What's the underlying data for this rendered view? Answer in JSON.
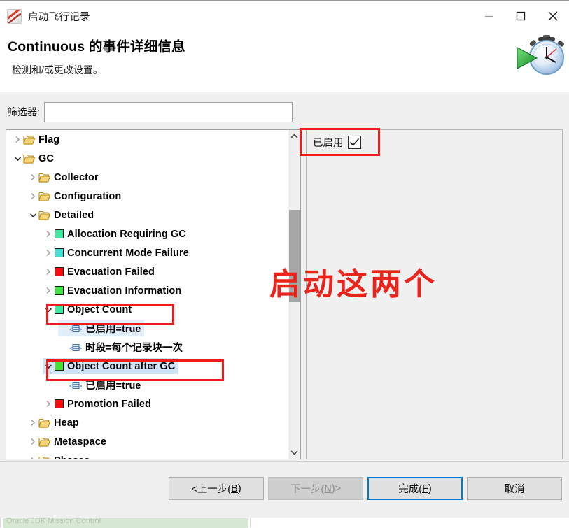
{
  "window": {
    "title": "启动飞行记录",
    "icon": "jfr-rocket-icon",
    "controls": {
      "minimize": "minimize-icon",
      "maximize": "maximize-icon",
      "close": "close-icon"
    }
  },
  "header": {
    "title": "Continuous 的事件详细信息",
    "subtitle": "检测和/或更改设置。",
    "art_icon": "stopwatch-play-icon"
  },
  "filter": {
    "label": "筛选器:",
    "value": "",
    "placeholder": ""
  },
  "tree": {
    "rows": [
      {
        "indent": 1,
        "twisty": "collapsed",
        "icon": "folder",
        "label": "Flag"
      },
      {
        "indent": 1,
        "twisty": "expanded",
        "icon": "folder",
        "label": "GC"
      },
      {
        "indent": 2,
        "twisty": "collapsed",
        "icon": "folder",
        "label": "Collector"
      },
      {
        "indent": 2,
        "twisty": "collapsed",
        "icon": "folder",
        "label": "Configuration"
      },
      {
        "indent": 2,
        "twisty": "expanded",
        "icon": "folder",
        "label": "Detailed"
      },
      {
        "indent": 3,
        "twisty": "collapsed",
        "icon": "color",
        "color": "#3ce9a0",
        "label": "Allocation Requiring GC"
      },
      {
        "indent": 3,
        "twisty": "collapsed",
        "icon": "color",
        "color": "#45e0d8",
        "label": "Concurrent Mode Failure"
      },
      {
        "indent": 3,
        "twisty": "collapsed",
        "icon": "color",
        "color": "#fa0a0a",
        "label": "Evacuation Failed"
      },
      {
        "indent": 3,
        "twisty": "collapsed",
        "icon": "color",
        "color": "#45e24a",
        "label": "Evacuation Information"
      },
      {
        "indent": 3,
        "twisty": "expanded",
        "icon": "color",
        "color": "#3ce9a0",
        "label": "Object Count",
        "annotated": true
      },
      {
        "indent": 4,
        "twisty": "none",
        "icon": "prop",
        "label": "已启用=true",
        "prop_selected": true
      },
      {
        "indent": 4,
        "twisty": "none",
        "icon": "prop",
        "label": "时段=每个记录块一次"
      },
      {
        "indent": 3,
        "twisty": "expanded",
        "icon": "color",
        "color": "#44e032",
        "label": "Object Count after GC",
        "selected": true,
        "annotated": true
      },
      {
        "indent": 4,
        "twisty": "none",
        "icon": "prop",
        "label": "已启用=true"
      },
      {
        "indent": 3,
        "twisty": "collapsed",
        "icon": "color",
        "color": "#fa0a0a",
        "label": "Promotion Failed"
      },
      {
        "indent": 2,
        "twisty": "collapsed",
        "icon": "folder",
        "label": "Heap"
      },
      {
        "indent": 2,
        "twisty": "collapsed",
        "icon": "folder",
        "label": "Metaspace"
      },
      {
        "indent": 2,
        "twisty": "collapsed",
        "icon": "folder",
        "label": "Phases"
      }
    ],
    "scrollbar": {
      "up_arrow": "chevron-up-icon",
      "down_arrow": "chevron-down-icon"
    }
  },
  "detail": {
    "enabled_label": "已启用",
    "enabled_checked": true
  },
  "footer": {
    "back": {
      "pre": "<上一步(",
      "key": "B",
      "post": ")",
      "disabled": false
    },
    "next": {
      "pre": "下一步(",
      "key": "N",
      "post": ")>",
      "disabled": true
    },
    "finish": {
      "pre": "完成(",
      "key": "F",
      "post": ")",
      "disabled": false,
      "default": true
    },
    "cancel": {
      "pre": "取消",
      "key": "",
      "post": "",
      "disabled": false
    }
  },
  "annotation": {
    "text": "启动这两个",
    "color": "#ee1c1c"
  },
  "background_window": {
    "text": "Oracle JDK Mission Control"
  }
}
